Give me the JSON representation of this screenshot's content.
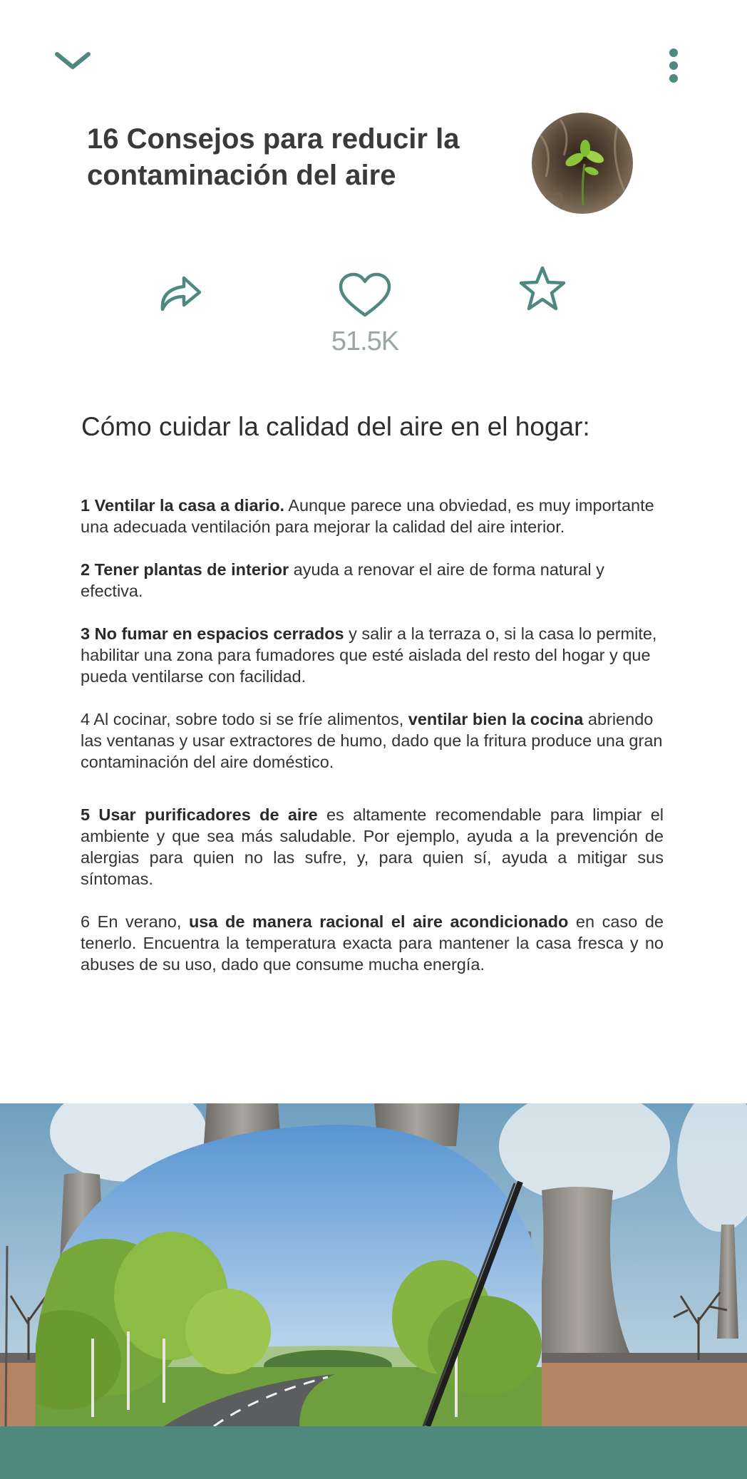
{
  "header": {
    "title": "16 Consejos para reducir la contaminación del aire",
    "back_icon": "chevron-down-icon",
    "menu_icon": "more-vertical-icon"
  },
  "actions": {
    "share_icon": "share-arrow-icon",
    "like_icon": "heart-icon",
    "like_count": "51.5K",
    "favorite_icon": "star-icon"
  },
  "article": {
    "subtitle": "Cómo cuidar la calidad del aire en el hogar:",
    "tips": [
      {
        "lead": "",
        "bold": "1 Ventilar la casa a diario.",
        "rest": " Aunque parece una obviedad, es muy importante una adecuada ventilación para mejorar la calidad del aire interior."
      },
      {
        "lead": "",
        "bold": "2 Tener plantas de interior",
        "rest": " ayuda a renovar el aire de forma natural y efectiva."
      },
      {
        "lead": "",
        "bold": "3 No fumar en espacios cerrados",
        "rest": " y salir a la terraza o, si la casa lo permite, habilitar una zona para fumadores que esté aislada del resto del hogar y que pueda ventilarse con facilidad."
      },
      {
        "lead": "4 Al cocinar, sobre todo si se fríe alimentos, ",
        "bold": "ventilar bien la cocina",
        "rest": " abriendo las ventanas y usar extractores de humo, dado que la fritura produce una gran contaminación del aire doméstico."
      },
      {
        "lead": "",
        "bold": "5 Usar purificadores de aire",
        "rest": " es altamente recomendable para limpiar el ambiente y que sea más saludable. Por ejemplo, ayuda a la prevención de alergias para quien no las sufre, y, para quien sí, ayuda a mitigar sus síntomas."
      },
      {
        "lead": "6 En verano, ",
        "bold": "usa de manera racional el aire acondicionado",
        "rest": " en caso de tenerlo. Encuentra la temperatura exacta para mantener la casa fresca y no abuses de su uso, dado que consume mucha energía."
      }
    ]
  },
  "colors": {
    "accent": "#4e887f",
    "count_gray": "#9aa7a4",
    "text": "#333333"
  }
}
